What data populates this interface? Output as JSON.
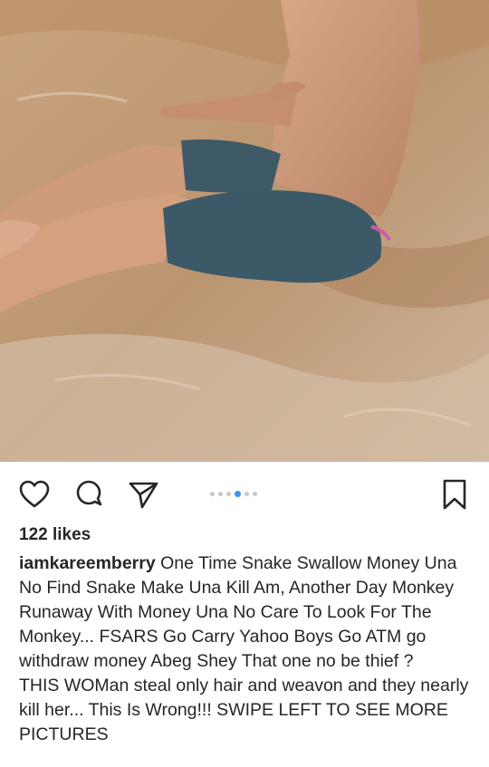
{
  "post": {
    "image_alt": "",
    "likes": "122 likes",
    "username": "iamkareemberry",
    "caption_part1": "One Time Snake Swallow Money Una No Find Snake Make Una Kill Am, Another Day Monkey Runaway With Money Una No Care To Look For The Monkey... FSARS Go Carry Yahoo Boys Go ATM go withdraw money Abeg Shey That one no be thief ?",
    "caption_part2": "THIS WOMan steal only hair and weavon and they nearly kill her... This Is Wrong!!! SWIPE LEFT TO SEE MORE PICTURES"
  },
  "carousel": {
    "total": 6,
    "active_index": 3
  },
  "icons": {
    "like": "heart-icon",
    "comment": "comment-bubble-icon",
    "share": "paper-plane-icon",
    "save": "bookmark-icon"
  }
}
